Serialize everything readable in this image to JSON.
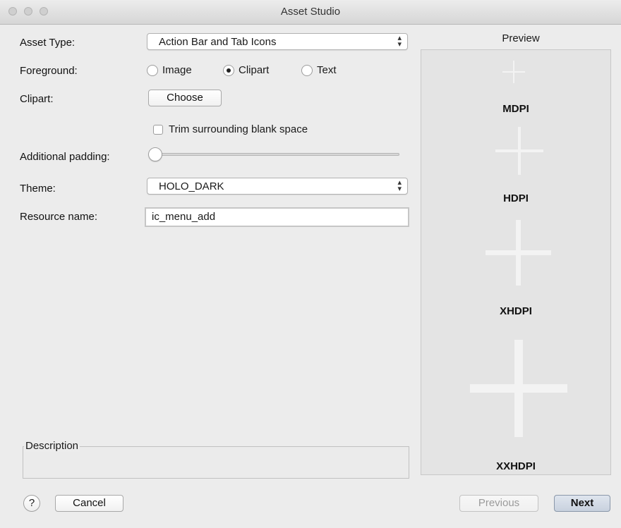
{
  "window": {
    "title": "Asset Studio"
  },
  "form": {
    "asset_type": {
      "label": "Asset Type:",
      "value": "Action Bar and Tab Icons"
    },
    "foreground": {
      "label": "Foreground:",
      "options": [
        "Image",
        "Clipart",
        "Text"
      ],
      "selected": "Clipart"
    },
    "clipart": {
      "label": "Clipart:",
      "button": "Choose"
    },
    "trim": {
      "label": "Trim surrounding blank space",
      "checked": false
    },
    "padding": {
      "label": "Additional padding:",
      "value_percent": 0
    },
    "theme": {
      "label": "Theme:",
      "value": "HOLO_DARK"
    },
    "resource_name": {
      "label": "Resource name:",
      "value": "ic_menu_add"
    }
  },
  "description": {
    "legend": "Description"
  },
  "preview": {
    "title": "Preview",
    "densities": [
      "MDPI",
      "HDPI",
      "XHDPI",
      "XXHDPI"
    ],
    "icon": "plus-icon"
  },
  "footer": {
    "help": "?",
    "cancel": "Cancel",
    "previous": "Previous",
    "next": "Next"
  }
}
